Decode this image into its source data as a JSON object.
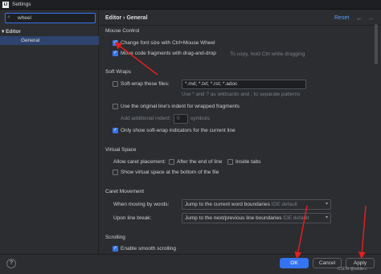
{
  "window": {
    "title": "Settings",
    "app_icon": "IJ"
  },
  "sidebar": {
    "search_value": "wheel",
    "tree": [
      {
        "label": "Editor",
        "expanded": true
      },
      {
        "label": "General",
        "selected": true
      }
    ]
  },
  "header": {
    "breadcrumb": "Editor  ›  General",
    "reset_label": "Reset",
    "back": "←",
    "forward": "→"
  },
  "mouse_control": {
    "heading": "Mouse Control",
    "change_font_size": {
      "label": "Change font size with Ctrl+Mouse Wheel",
      "checked": true
    },
    "move_code": {
      "label": "Move code fragments with drag-and-drop",
      "checked": true,
      "hint": "To copy, hold Ctrl while dragging"
    }
  },
  "soft_wraps": {
    "heading": "Soft Wraps",
    "soft_wrap_files": {
      "label": "Soft-wrap these files:",
      "checked": false,
      "value": "*.md; *.txt; *.rst; *.adoc",
      "hint": "Use * and ? as wildcards and ; to separate patterns"
    },
    "original_indent": {
      "label": "Use the original line's indent for wrapped fragments",
      "checked": false
    },
    "additional_indent": {
      "label": "Add additional indent:",
      "value": "0",
      "unit": "symbols"
    },
    "only_show": {
      "label": "Only show soft-wrap indicators for the current line",
      "checked": true
    }
  },
  "virtual_space": {
    "heading": "Virtual Space",
    "allow_caret_label": "Allow caret placement:",
    "after_end_of_line": {
      "label": "After the end of line",
      "checked": false
    },
    "inside_tabs": {
      "label": "Inside tabs",
      "checked": false
    },
    "show_virtual_space": {
      "label": "Show virtual space at the bottom of the file",
      "checked": false
    }
  },
  "caret_movement": {
    "heading": "Caret Movement",
    "moving_by_words": {
      "label": "When moving by words:",
      "value": "Jump to the current word boundaries",
      "hint": "IDE default"
    },
    "upon_line_break": {
      "label": "Upon line break:",
      "value": "Jump to the next/previous line boundaries",
      "hint": "IDE default"
    }
  },
  "scrolling": {
    "heading": "Scrolling",
    "smooth_scrolling": {
      "label": "Enable smooth scrolling",
      "checked": true
    }
  },
  "footer": {
    "help": "?",
    "ok": "OK",
    "cancel": "Cancel",
    "apply": "Apply",
    "watermark": "CSDN @eddie.c"
  },
  "colors": {
    "accent": "#3574f0",
    "annotation_arrow": "#e02020",
    "background": "#2b2d30"
  }
}
